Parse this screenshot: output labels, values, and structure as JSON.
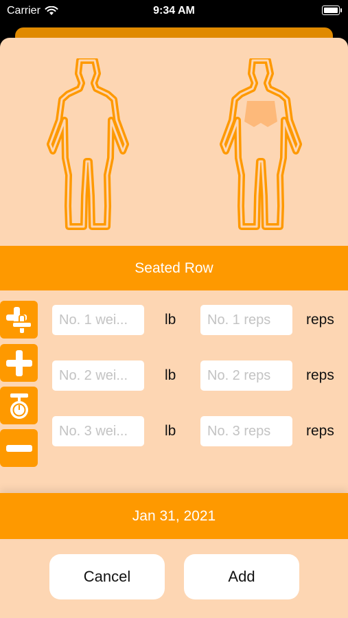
{
  "status_bar": {
    "carrier": "Carrier",
    "time": "9:34 AM",
    "icons": [
      "wifi-icon",
      "battery-icon"
    ]
  },
  "muscle_map": {
    "front_figure": "body-front-icon",
    "back_figure": "body-back-highlighted-icon",
    "colors": {
      "outline": "#fe9900",
      "highlight": "#fdb97a"
    }
  },
  "exercise": {
    "name": "Seated Row"
  },
  "side_buttons": [
    {
      "icon": "add-multiple-sets-icon"
    },
    {
      "icon": "plus-icon"
    },
    {
      "icon": "scale-icon"
    },
    {
      "icon": "minus-icon"
    }
  ],
  "sets": [
    {
      "weight_placeholder": "No. 1 wei...",
      "weight_unit": "lb",
      "reps_placeholder": "No. 1 reps",
      "reps_unit": "reps"
    },
    {
      "weight_placeholder": "No. 2 wei...",
      "weight_unit": "lb",
      "reps_placeholder": "No. 2 reps",
      "reps_unit": "reps"
    },
    {
      "weight_placeholder": "No. 3 wei...",
      "weight_unit": "lb",
      "reps_placeholder": "No. 3 reps",
      "reps_unit": "reps"
    }
  ],
  "date": "Jan 31, 2021",
  "actions": {
    "cancel_label": "Cancel",
    "add_label": "Add"
  },
  "colors": {
    "accent": "#fe9900",
    "background": "#fdd6b3",
    "field": "#ffffff"
  }
}
